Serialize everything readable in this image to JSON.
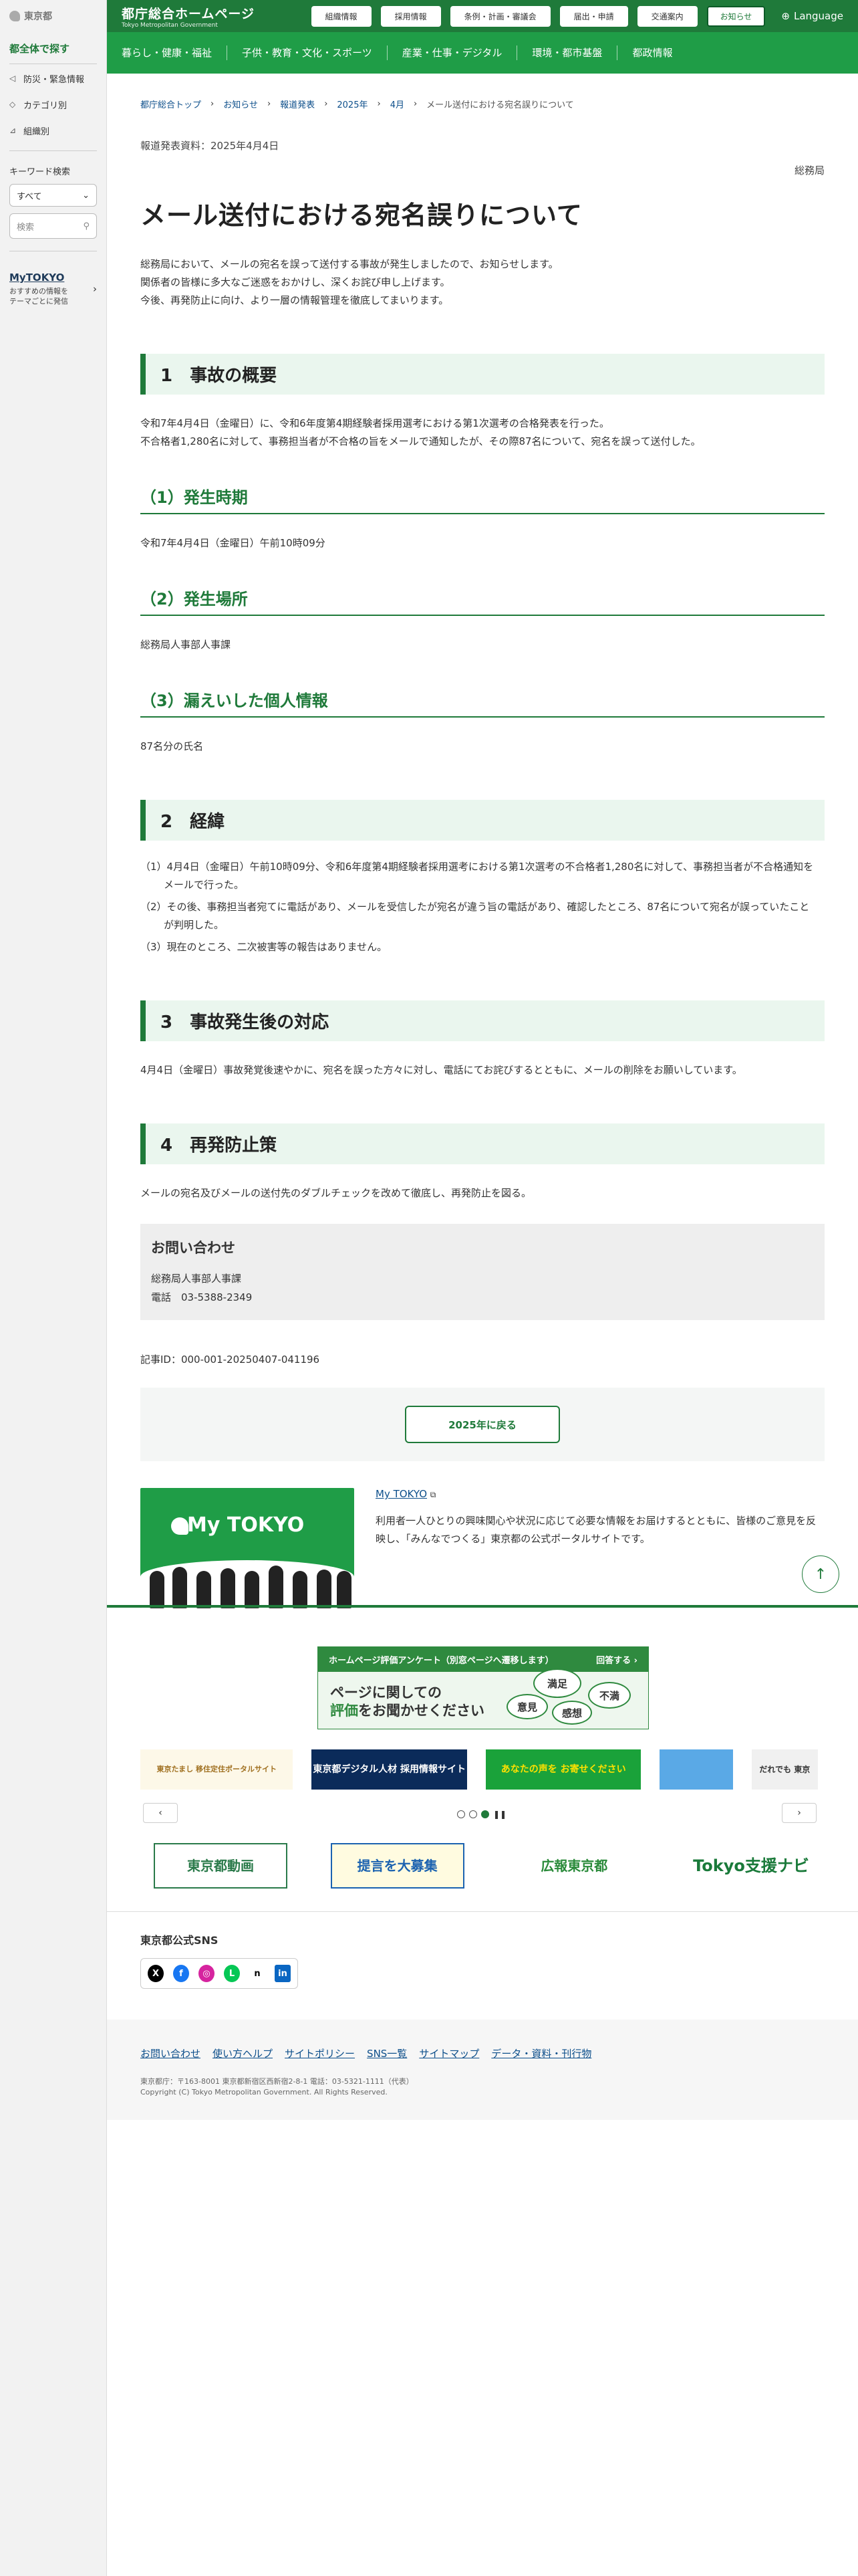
{
  "sidebar": {
    "logo": "東京都",
    "title": "都全体で探す",
    "items": [
      {
        "icon": "megaphone-icon",
        "label": "防災・緊急情報"
      },
      {
        "icon": "tag-icon",
        "label": "カテゴリ別"
      },
      {
        "icon": "org-icon",
        "label": "組織別"
      }
    ],
    "keyword_label": "キーワード検索",
    "select_value": "すべて",
    "search_placeholder": "検索",
    "mytokyo_title": "MyTOKYO",
    "mytokyo_desc1": "おすすめの情報を",
    "mytokyo_desc2": "テーマごとに発信"
  },
  "header": {
    "title": "都庁総合ホームページ",
    "subtitle": "Tokyo Metropolitan Government",
    "nav": [
      "組織情報",
      "採用情報",
      "条例・計画・審議会",
      "届出・申請",
      "交通案内",
      "お知らせ"
    ],
    "language": "Language"
  },
  "gnav": [
    "暮らし・健康・福祉",
    "子供・教育・文化・スポーツ",
    "産業・仕事・デジタル",
    "環境・都市基盤",
    "都政情報"
  ],
  "breadcrumb": [
    "都庁総合トップ",
    "お知らせ",
    "報道発表",
    "2025年",
    "4月",
    "メール送付における宛名誤りについて"
  ],
  "article": {
    "press_date": "報道発表資料：2025年4月4日",
    "dept": "総務局",
    "title": "メール送付における宛名誤りについて",
    "lead": [
      "総務局において、メールの宛名を誤って送付する事故が発生しましたので、お知らせします。",
      "関係者の皆様に多大なご迷惑をおかけし、深くお詫び申し上げます。",
      "今後、再発防止に向け、より一層の情報管理を徹底してまいります。"
    ],
    "s1_title": "1　事故の概要",
    "s1_p1": "令和7年4月4日（金曜日）に、令和6年度第4期経験者採用選考における第1次選考の合格発表を行った。",
    "s1_p2": "不合格者1,280名に対して、事務担当者が不合格の旨をメールで通知したが、その際87名について、宛名を誤って送付した。",
    "s1a_title": "（1）発生時期",
    "s1a_p": "令和7年4月4日（金曜日）午前10時09分",
    "s1b_title": "（2）発生場所",
    "s1b_p": "総務局人事部人事課",
    "s1c_title": "（3）漏えいした個人情報",
    "s1c_p": "87名分の氏名",
    "s2_title": "2　経緯",
    "s2_items": [
      "（1）4月4日（金曜日）午前10時09分、令和6年度第4期経験者採用選考における第1次選考の不合格者1,280名に対して、事務担当者が不合格通知をメールで行った。",
      "（2）その後、事務担当者宛てに電話があり、メールを受信したが宛名が違う旨の電話があり、確認したところ、87名について宛名が誤っていたことが判明した。",
      "（3）現在のところ、二次被害等の報告はありません。"
    ],
    "s3_title": "3　事故発生後の対応",
    "s3_p": "4月4日（金曜日）事故発覚後速やかに、宛名を誤った方々に対し、電話にてお詫びするとともに、メールの削除をお願いしています。",
    "s4_title": "4　再発防止策",
    "s4_p": "メールの宛名及びメールの送付先のダブルチェックを改めて徹底し、再発防止を図る。",
    "contact_title": "お問い合わせ",
    "contact_dept": "総務局人事部人事課",
    "contact_tel": "電話　03-5388-2349",
    "article_id": "記事ID：000-001-20250407-041196",
    "back_button": "2025年に戻る"
  },
  "mytokyo": {
    "image_text": "My TOKYO",
    "link": "My TOKYO",
    "desc": "利用者一人ひとりの興味関心や状況に応じて必要な情報をお届けするとともに、皆様のご意見を反映し、「みんなでつくる」東京都の公式ポータルサイトです。"
  },
  "footer": {
    "survey_head": "ホームページ評価アンケート（別窓ページへ遷移します）",
    "survey_answer": "回答する ›",
    "survey_l1": "ページに関しての",
    "survey_l2a": "評価",
    "survey_l2b": "をお聞かせください",
    "bubbles": [
      "満足",
      "不満",
      "意見",
      "感想"
    ],
    "banners": [
      "東京たまし 移住定住ポータルサイト",
      "東京都デジタル人材 採用情報サイト",
      "あなたの声を お寄せください",
      "",
      "だれでも 東京"
    ],
    "banners2": [
      "東京都動画",
      "提言を大募集",
      "広報東京都",
      "Tokyo支援ナビ"
    ],
    "sns_title": "東京都公式SNS",
    "sns": [
      "X",
      "f",
      "◎",
      "L",
      "n",
      "in"
    ],
    "links": [
      "お問い合わせ",
      "使い方ヘルプ",
      "サイトポリシー",
      "SNS一覧",
      "サイトマップ",
      "データ・資料・刊行物"
    ],
    "address": "東京都庁：〒163-8001 東京都新宿区西新宿2-8-1 電話：03-5321-1111（代表）",
    "copyright": "Copyright (C) Tokyo Metropolitan Government. All Rights Reserved."
  },
  "colors": {
    "brand": "#1f7a3a",
    "nav": "#1f9d47",
    "section_bg": "#eaf6ee"
  }
}
